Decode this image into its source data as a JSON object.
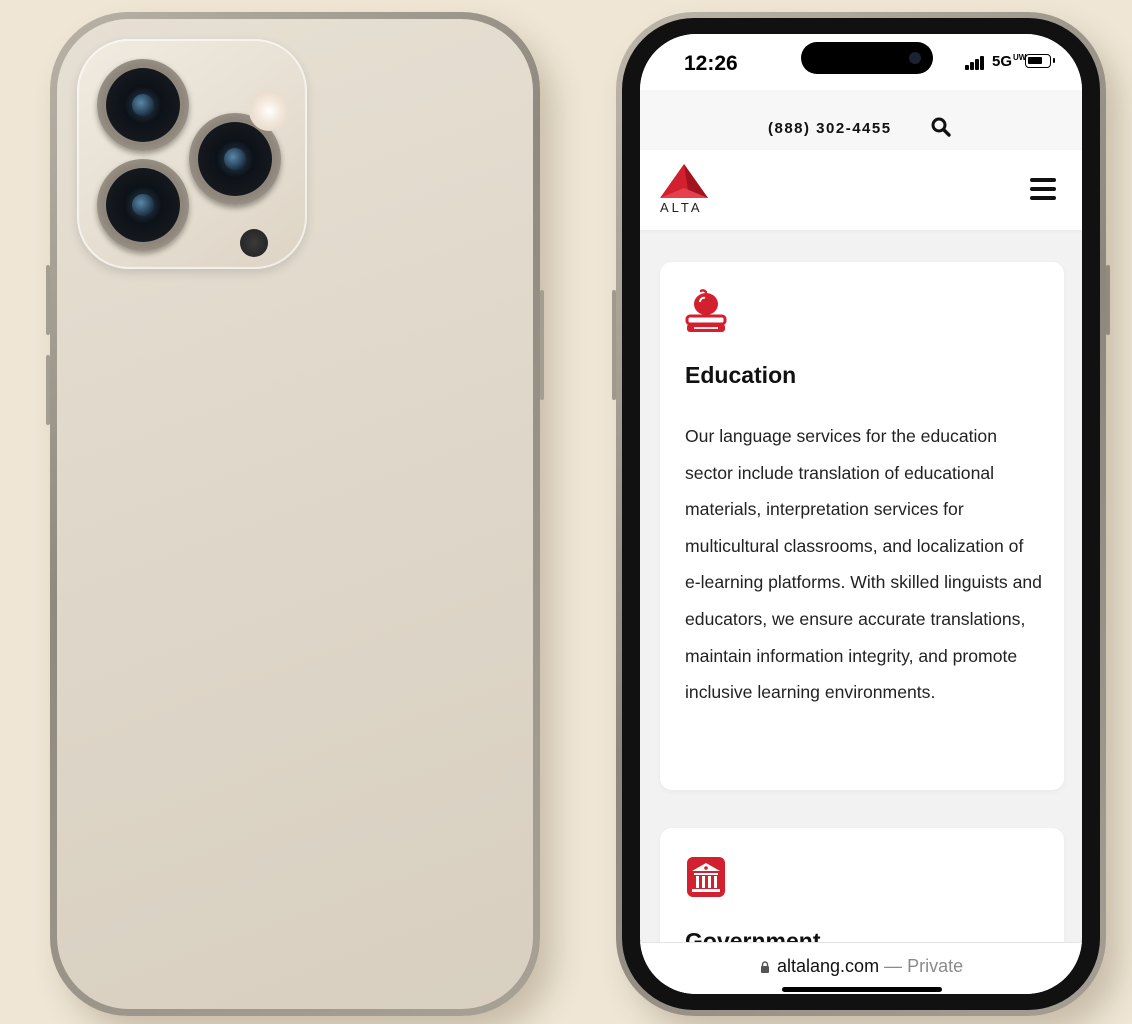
{
  "status_bar": {
    "time": "12:26",
    "network": "5G",
    "network_suffix": "UW"
  },
  "topbar": {
    "phone": "(888) 302-4455",
    "search_icon": "search-icon"
  },
  "header": {
    "logo_text": "ALTA",
    "menu_icon": "hamburger-menu-icon"
  },
  "cards": [
    {
      "icon": "apple-book-icon",
      "title": "Education",
      "body": "Our language services for the education sector include translation of educational materials, interpretation services for multicultural classrooms, and localization of e-learning platforms. With skilled linguists and educators, we ensure accurate translations, maintain information integrity, and promote inclusive learning environments."
    },
    {
      "icon": "government-building-icon",
      "title": "Government"
    }
  ],
  "url_bar": {
    "domain": "altalang.com",
    "separator": " — ",
    "mode": "Private"
  },
  "colors": {
    "brand_red": "#d3202f",
    "page_bg": "#efe6d6",
    "phone_finish": "#ddd5c7"
  }
}
